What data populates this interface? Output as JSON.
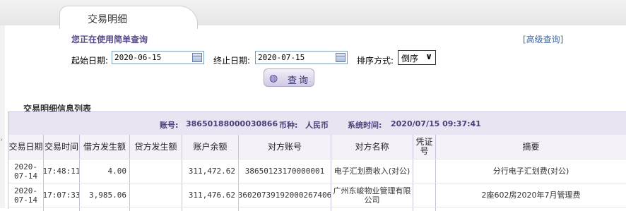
{
  "tab": {
    "title": "交易明细"
  },
  "query": {
    "hint": "您正在使用简单查询",
    "advanced_link": "[高级查询]",
    "start_label": "起始日期:",
    "start_value": "2020-06-15",
    "end_label": "终止日期:",
    "end_value": "2020-07-15",
    "sort_label": "排序方式:",
    "sort_value": "倒序",
    "button_label": "查询"
  },
  "list": {
    "title": "交易明细信息列表",
    "account_label": "账号:",
    "account_no": "38650188000030866",
    "currency_label": "币种:",
    "currency": "人民币",
    "systime_label": "系统时间:",
    "systime": "2020/07/15 09:37:41",
    "headers": [
      "交易日期",
      "交易时间",
      "借方发生额",
      "贷方发生额",
      "账户余额",
      "对方账号",
      "对方名称",
      "凭证号",
      "摘要"
    ],
    "rows": [
      {
        "date": "2020-07-14",
        "time": "17:48:11",
        "debit": "4.00",
        "credit": "",
        "balance": "311,472.62",
        "counter_acct": "38650123170000001",
        "counter_name": "电子汇划费收入(对公)",
        "voucher": "",
        "memo": "分行电子汇划费(对公)"
      },
      {
        "date": "2020-07-14",
        "time": "17:07:33",
        "debit": "3,985.06",
        "credit": "",
        "balance": "311,476.62",
        "counter_acct": "36020739192000267406",
        "counter_name": "广州东峻物业管理有限公司",
        "voucher": "",
        "memo": "2座602房2020年7月管理费"
      }
    ]
  }
}
